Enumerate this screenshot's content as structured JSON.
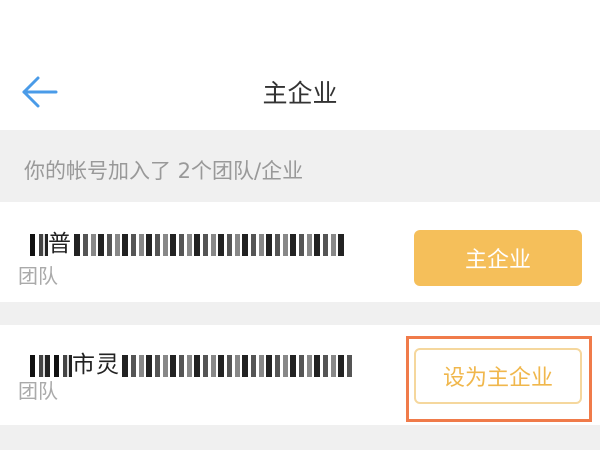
{
  "header": {
    "title": "主企业",
    "back_icon": "arrow-left-icon"
  },
  "section": {
    "summary": "你的帐号加入了 2个团队/企业"
  },
  "companies": [
    {
      "name_visible_prefix": "",
      "name_visible_mid": "普",
      "type": "团队",
      "action_label": "主企业",
      "is_primary": true
    },
    {
      "name_visible_prefix": "",
      "name_visible_mid": "市灵",
      "type": "团队",
      "action_label": "设为主企业",
      "is_primary": false
    }
  ],
  "colors": {
    "accent": "#f5bf5a",
    "accent_text": "#f0b74c",
    "back_arrow": "#4a9be8",
    "highlight_box": "#f07b4a",
    "section_bg": "#f0f0f0"
  }
}
